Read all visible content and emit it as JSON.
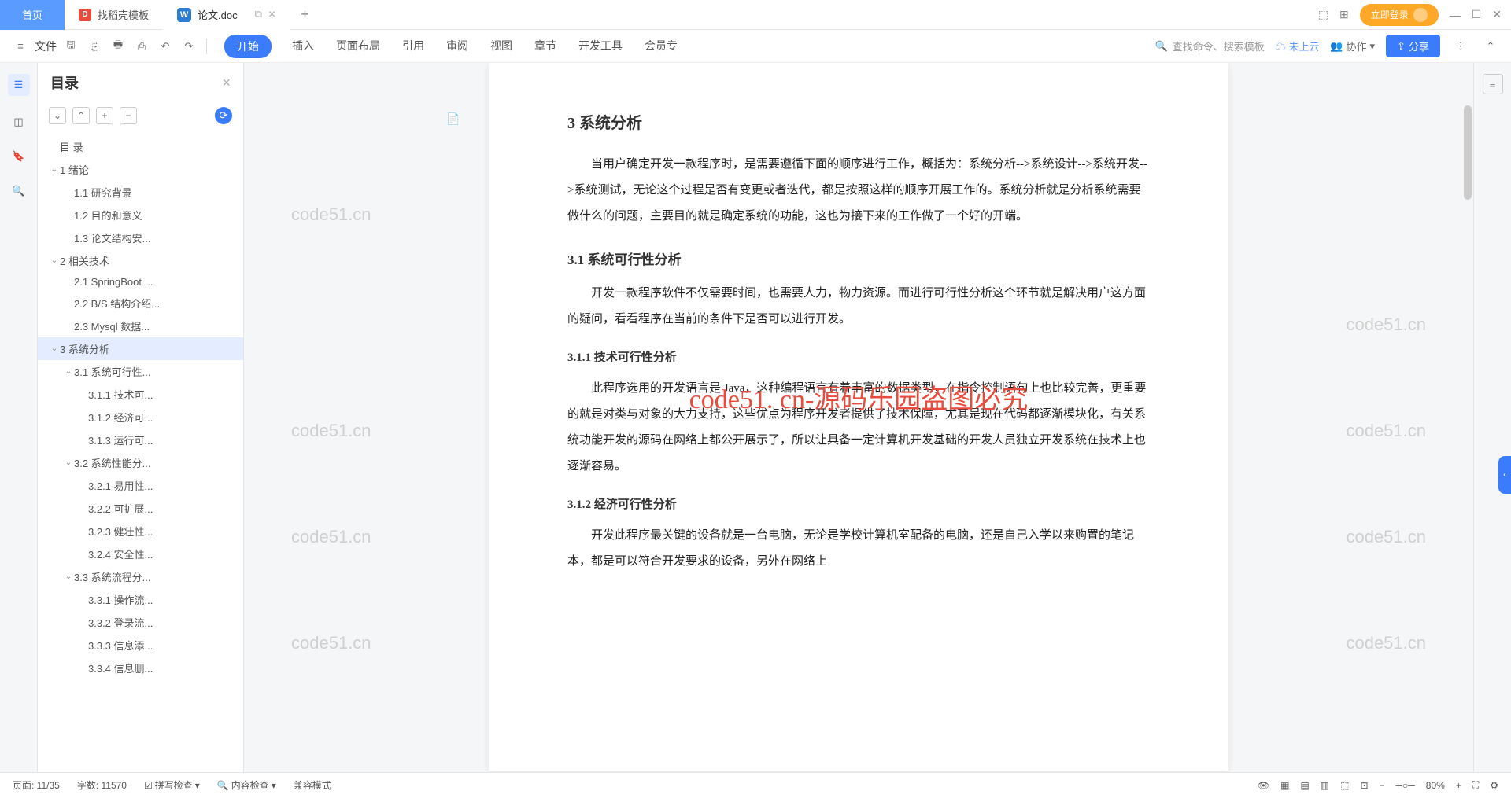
{
  "tabs": {
    "home": "首页",
    "find": "找稻壳模板",
    "doc": "论文.doc"
  },
  "titlebar": {
    "login": "立即登录"
  },
  "ribbon": {
    "file": "文件",
    "tabs": [
      "开始",
      "插入",
      "页面布局",
      "引用",
      "审阅",
      "视图",
      "章节",
      "开发工具",
      "会员专"
    ],
    "search": "查找命令、搜索模板",
    "cloud": "未上云",
    "coop": "协作",
    "share": "分享"
  },
  "toc": {
    "title": "目录",
    "items": [
      {
        "t": "目 录",
        "lv": 0,
        "chev": ""
      },
      {
        "t": "1 绪论",
        "lv": 0,
        "chev": "⌄"
      },
      {
        "t": "1.1 研究背景",
        "lv": 1,
        "chev": ""
      },
      {
        "t": "1.2 目的和意义",
        "lv": 1,
        "chev": ""
      },
      {
        "t": "1.3 论文结构安...",
        "lv": 1,
        "chev": ""
      },
      {
        "t": "2 相关技术",
        "lv": 0,
        "chev": "⌄"
      },
      {
        "t": "2.1 SpringBoot ...",
        "lv": 1,
        "chev": ""
      },
      {
        "t": "2.2 B/S 结构介绍...",
        "lv": 1,
        "chev": ""
      },
      {
        "t": "2.3 Mysql 数据...",
        "lv": 1,
        "chev": ""
      },
      {
        "t": "3 系统分析",
        "lv": 0,
        "chev": "⌄",
        "sel": true
      },
      {
        "t": "3.1 系统可行性...",
        "lv": 1,
        "chev": "⌄"
      },
      {
        "t": "3.1.1 技术可...",
        "lv": 2,
        "chev": ""
      },
      {
        "t": "3.1.2 经济可...",
        "lv": 2,
        "chev": ""
      },
      {
        "t": "3.1.3 运行可...",
        "lv": 2,
        "chev": ""
      },
      {
        "t": "3.2 系统性能分...",
        "lv": 1,
        "chev": "⌄"
      },
      {
        "t": "3.2.1 易用性...",
        "lv": 2,
        "chev": ""
      },
      {
        "t": "3.2.2 可扩展...",
        "lv": 2,
        "chev": ""
      },
      {
        "t": "3.2.3 健壮性...",
        "lv": 2,
        "chev": ""
      },
      {
        "t": "3.2.4 安全性...",
        "lv": 2,
        "chev": ""
      },
      {
        "t": "3.3 系统流程分...",
        "lv": 1,
        "chev": "⌄"
      },
      {
        "t": "3.3.1 操作流...",
        "lv": 2,
        "chev": ""
      },
      {
        "t": "3.3.2 登录流...",
        "lv": 2,
        "chev": ""
      },
      {
        "t": "3.3.3 信息添...",
        "lv": 2,
        "chev": ""
      },
      {
        "t": "3.3.4 信息删...",
        "lv": 2,
        "chev": ""
      }
    ]
  },
  "doc": {
    "h2": "3  系统分析",
    "p1": "当用户确定开发一款程序时，是需要遵循下面的顺序进行工作，概括为：系统分析-->系统设计-->系统开发-->系统测试，无论这个过程是否有变更或者迭代，都是按照这样的顺序开展工作的。系统分析就是分析系统需要做什么的问题，主要目的就是确定系统的功能，这也为接下来的工作做了一个好的开端。",
    "h3_1": "3.1  系统可行性分析",
    "p2": "开发一款程序软件不仅需要时间，也需要人力，物力资源。而进行可行性分析这个环节就是解决用户这方面的疑问，看看程序在当前的条件下是否可以进行开发。",
    "h4_1": "3.1.1  技术可行性分析",
    "p3": "此程序选用的开发语言是 Java，这种编程语言有着丰富的数据类型，在指令控制语句上也比较完善，更重要的就是对类与对象的大力支持，这些优点为程序开发者提供了技术保障，尤其是现在代码都逐渐模块化，有关系统功能开发的源码在网络上都公开展示了，所以让具备一定计算机开发基础的开发人员独立开发系统在技术上也逐渐容易。",
    "h4_2": "3.1.2  经济可行性分析",
    "p4": "开发此程序最关键的设备就是一台电脑，无论是学校计算机室配备的电脑，还是自己入学以来购置的笔记本，都是可以符合开发要求的设备，另外在网络上",
    "wm": "code51.cn",
    "wmred": "code51. cn-源码乐园盗图必究"
  },
  "status": {
    "page": "页面: 11/35",
    "words": "字数: 11570",
    "spell": "拼写检查",
    "content": "内容检查",
    "compat": "兼容模式",
    "zoom": "80%"
  }
}
